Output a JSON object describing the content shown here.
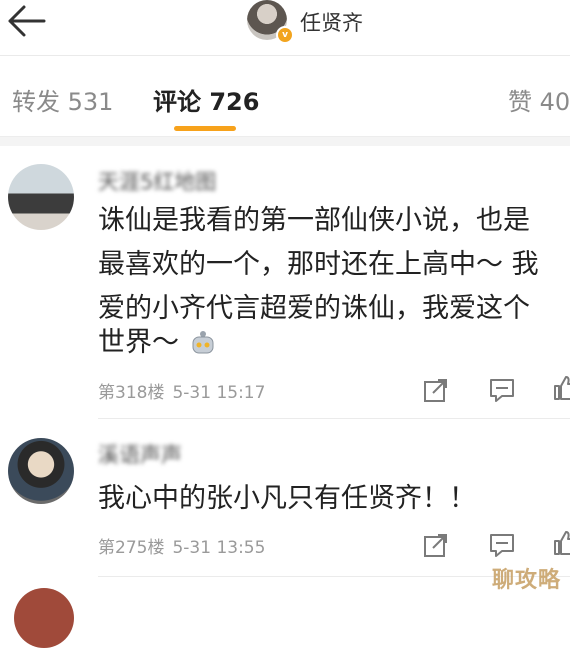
{
  "header": {
    "user_name": "任贤齐",
    "badge": "v"
  },
  "tabs": [
    {
      "label": "转发 531"
    },
    {
      "label": "评论 726"
    },
    {
      "label": "赞 40"
    }
  ],
  "comments": [
    {
      "name": "天涯5红地图",
      "lines": [
        "诛仙是我看的第一部仙侠小说，也是",
        "最喜欢的一个，那时还在上高中～ 我",
        "爱的小齐代言超爱的诛仙，我爱这个",
        "世界～"
      ],
      "floor": "第318楼",
      "time": "5-31 15:17"
    },
    {
      "name": "溪语声声",
      "lines": [
        "我心中的张小凡只有任贤齐！！"
      ],
      "floor": "第275楼",
      "time": "5-31 13:55"
    }
  ],
  "watermark": "聊攻略",
  "colors": {
    "accent": "#f7a21b",
    "badge": "#f2a41e"
  }
}
